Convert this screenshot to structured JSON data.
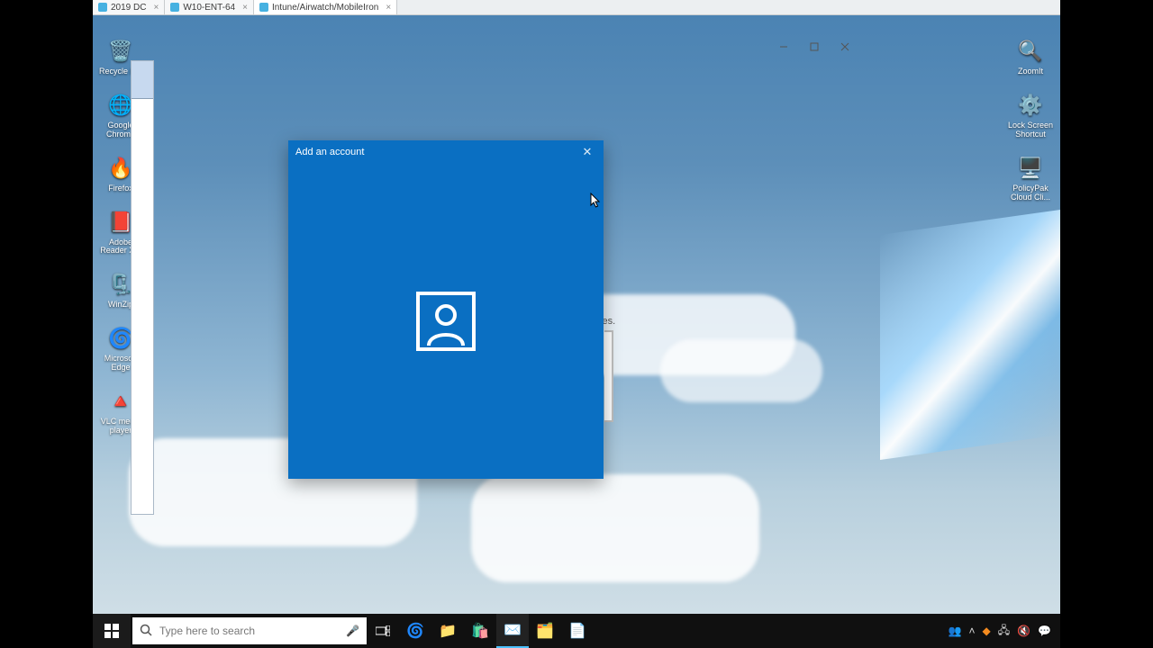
{
  "tabs": [
    {
      "label": "2019 DC"
    },
    {
      "label": "W10-ENT-64"
    },
    {
      "label": "Intune/Airwatch/MobileIron"
    }
  ],
  "left_icons": [
    {
      "name": "recycle-bin",
      "label": "Recycle B...",
      "glyph": "🗑️"
    },
    {
      "name": "chrome",
      "label": "Google Chrome",
      "glyph": "🌐"
    },
    {
      "name": "firefox",
      "label": "Firefox",
      "glyph": "🔥"
    },
    {
      "name": "adobe",
      "label": "Adobe Reader X...",
      "glyph": "📕"
    },
    {
      "name": "winzip",
      "label": "WinZip",
      "glyph": "🗜️"
    },
    {
      "name": "edge",
      "label": "Microsoft Edge",
      "glyph": "🌀"
    },
    {
      "name": "vlc",
      "label": "VLC media player",
      "glyph": "🔺"
    }
  ],
  "right_icons": [
    {
      "name": "zoomit",
      "label": "ZoomIt",
      "glyph": "🔍"
    },
    {
      "name": "lockscreen",
      "label": "Lock Screen Shortcut",
      "glyph": "⚙️"
    },
    {
      "name": "policypak",
      "label": "PolicyPak Cloud Cli...",
      "glyph": "🖥️"
    }
  ],
  "modal": {
    "title": "Add an account"
  },
  "peek": {
    "text": "ces."
  },
  "search": {
    "placeholder": "Type here to search"
  }
}
